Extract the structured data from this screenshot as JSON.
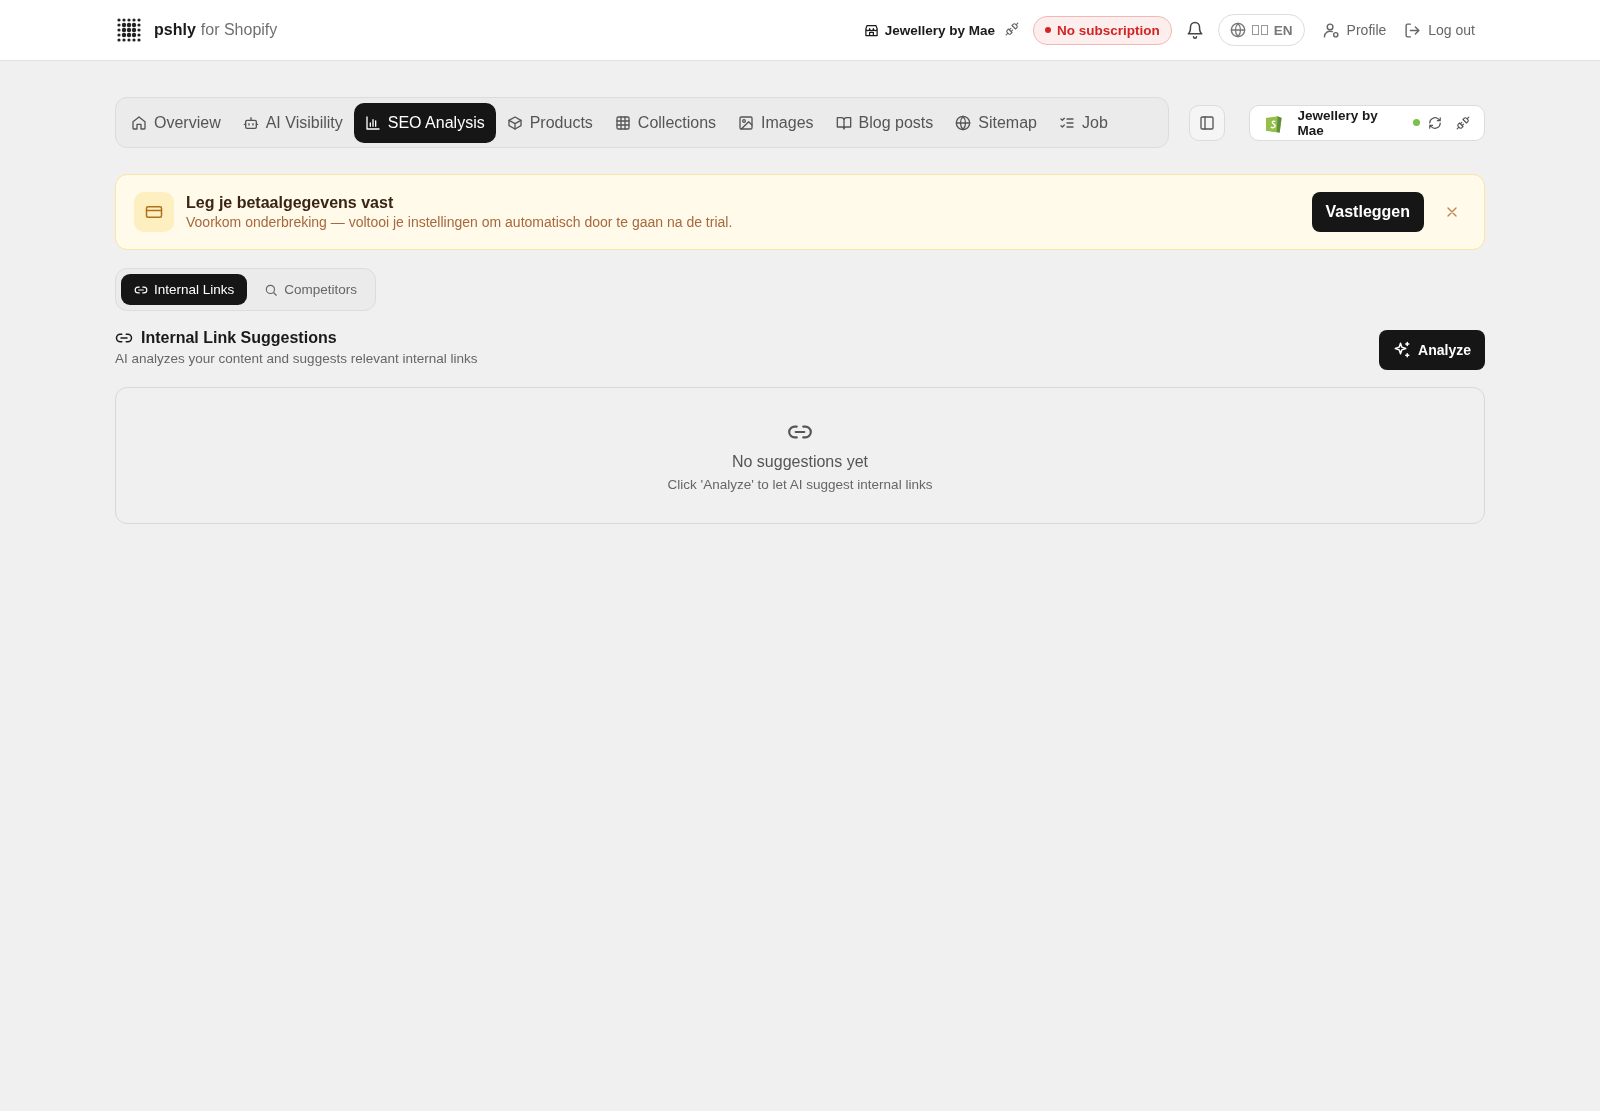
{
  "header": {
    "brand": "pshly",
    "brand_suffix": "for Shopify",
    "store": "Jewellery by Mae",
    "subscription": "No subscription",
    "language": "EN",
    "profile": "Profile",
    "logout": "Log out"
  },
  "tabs": [
    {
      "label": "Overview",
      "selected": false
    },
    {
      "label": "AI Visibility",
      "selected": false
    },
    {
      "label": "SEO Analysis",
      "selected": true
    },
    {
      "label": "Products",
      "selected": false
    },
    {
      "label": "Collections",
      "selected": false
    },
    {
      "label": "Images",
      "selected": false
    },
    {
      "label": "Blog posts",
      "selected": false
    },
    {
      "label": "Sitemap",
      "selected": false
    },
    {
      "label": "Job",
      "selected": false
    }
  ],
  "store_card": {
    "name": "Jewellery by Mae",
    "connected": true
  },
  "banner": {
    "title": "Leg je betaalgegevens vast",
    "message": "Voorkom onderbreking — voltooi je instellingen om automatisch door te gaan na de trial.",
    "action": "Vastleggen"
  },
  "subtabs": [
    {
      "label": "Internal Links",
      "selected": true
    },
    {
      "label": "Competitors",
      "selected": false
    }
  ],
  "section": {
    "title": "Internal Link Suggestions",
    "subtitle": "AI analyzes your content and suggests relevant internal links",
    "action": "Analyze",
    "empty_title": "No suggestions yet",
    "empty_message": "Click 'Analyze' to let AI suggest internal links"
  }
}
